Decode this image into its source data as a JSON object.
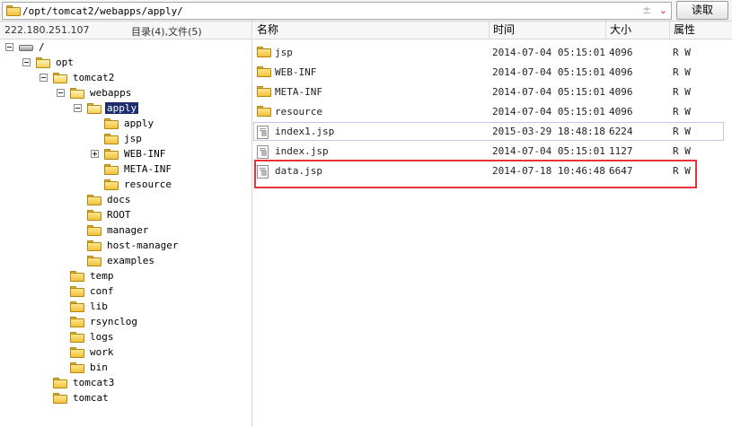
{
  "address": {
    "path": "/opt/tomcat2/webapps/apply/",
    "plus_minus": "±",
    "dropdown": "⌄",
    "read_button": "读取"
  },
  "left_header": {
    "ip": "222.180.251.107",
    "counts": "目录(4),文件(5)"
  },
  "tree": {
    "root": "/",
    "opt": "opt",
    "tomcat2": "tomcat2",
    "webapps": "webapps",
    "apply": "apply",
    "apply_sub": "apply",
    "jsp": "jsp",
    "webinf": "WEB-INF",
    "metainf": "META-INF",
    "resource": "resource",
    "docs": "docs",
    "root_dir": "ROOT",
    "manager": "manager",
    "host_manager": "host-manager",
    "examples": "examples",
    "temp": "temp",
    "conf": "conf",
    "lib": "lib",
    "rsynclog": "rsynclog",
    "logs": "logs",
    "work": "work",
    "bin": "bin",
    "tomcat3": "tomcat3",
    "tomcat": "tomcat"
  },
  "columns": {
    "name": "名称",
    "time": "时间",
    "size": "大小",
    "attr": "属性"
  },
  "files": [
    {
      "name": "jsp",
      "time": "2014-07-04 05:15:01",
      "size": "4096",
      "attr": "R W",
      "type": "folder"
    },
    {
      "name": "WEB-INF",
      "time": "2014-07-04 05:15:01",
      "size": "4096",
      "attr": "R W",
      "type": "folder"
    },
    {
      "name": "META-INF",
      "time": "2014-07-04 05:15:01",
      "size": "4096",
      "attr": "R W",
      "type": "folder"
    },
    {
      "name": "resource",
      "time": "2014-07-04 05:15:01",
      "size": "4096",
      "attr": "R W",
      "type": "folder"
    },
    {
      "name": "index1.jsp",
      "time": "2015-03-29 18:48:18",
      "size": "6224",
      "attr": "R W",
      "type": "file"
    },
    {
      "name": "index.jsp",
      "time": "2014-07-04 05:15:01",
      "size": "1127",
      "attr": "R W",
      "type": "file"
    },
    {
      "name": "data.jsp",
      "time": "2014-07-18 10:46:48",
      "size": "6647",
      "attr": "R W",
      "type": "file"
    }
  ],
  "colors": {
    "selection": "#1e2e6f",
    "highlight_border": "#e8323a",
    "folder": "#f1c23c"
  }
}
